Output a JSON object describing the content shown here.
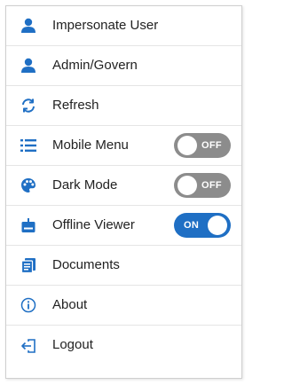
{
  "colors": {
    "icon": "#1f6fc4",
    "toggle_on": "#1f6fc4",
    "toggle_off": "#8c8c8c",
    "text": "#222222"
  },
  "menu": {
    "items": [
      {
        "label": "Impersonate User",
        "icon": "user-icon"
      },
      {
        "label": "Admin/Govern",
        "icon": "user-icon"
      },
      {
        "label": "Refresh",
        "icon": "refresh-icon"
      },
      {
        "label": "Mobile Menu",
        "icon": "list-icon",
        "toggle": {
          "state": false,
          "text": "OFF"
        }
      },
      {
        "label": "Dark Mode",
        "icon": "palette-icon",
        "toggle": {
          "state": false,
          "text": "OFF"
        }
      },
      {
        "label": "Offline Viewer",
        "icon": "download-icon",
        "toggle": {
          "state": true,
          "text": "ON"
        }
      },
      {
        "label": "Documents",
        "icon": "documents-icon"
      },
      {
        "label": "About",
        "icon": "info-icon"
      },
      {
        "label": "Logout",
        "icon": "logout-icon"
      }
    ]
  }
}
